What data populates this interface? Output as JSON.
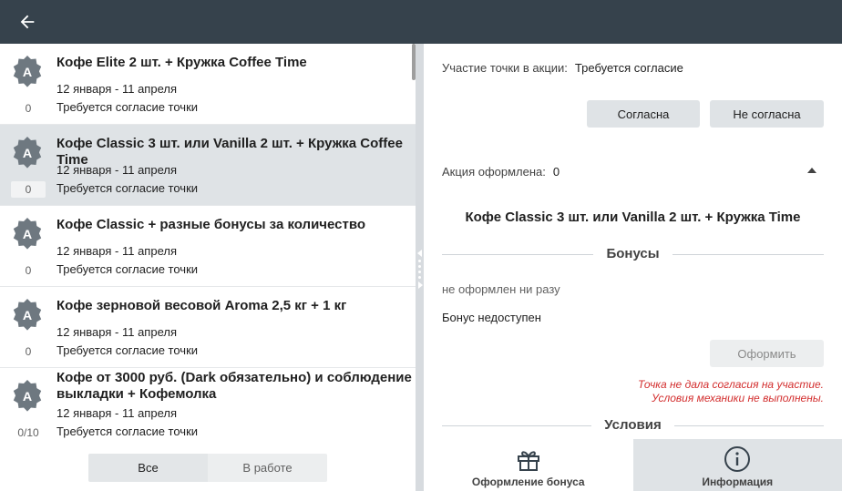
{
  "header": {
    "back_icon": "arrow-left-icon"
  },
  "promos": [
    {
      "title": "Кофе Elite 2 шт. + Кружка Coffee Time",
      "dates": "12 января - 11 апреля",
      "status": "Требуется согласие точки",
      "count": "0",
      "badge": "А",
      "badge_icon": "star-badge-icon"
    },
    {
      "title": "Кофе Classic 3 шт. или Vanilla 2 шт. + Кружка Coffee Time",
      "dates": "12 января - 11 апреля",
      "status": "Требуется согласие точки",
      "count": "0",
      "badge": "А",
      "badge_icon": "star-badge-icon"
    },
    {
      "title": "Кофе Classic + разные бонусы за количество",
      "dates": "12 января - 11 апреля",
      "status": "Требуется согласие точки",
      "count": "0",
      "badge": "А",
      "badge_icon": "star-badge-icon"
    },
    {
      "title": "Кофе зерновой весовой Aroma 2,5 кг + 1 кг",
      "dates": "12 января - 11 апреля",
      "status": "Требуется согласие точки",
      "count": "0",
      "badge": "А",
      "badge_icon": "star-badge-icon"
    },
    {
      "title": "Кофе от 3000 руб. (Dark обязательно) и соблюдение выкладки + Кофемолка",
      "dates": "12 января - 11 апреля",
      "status": "Требуется согласие точки",
      "count": "0/10",
      "badge": "А",
      "badge_icon": "star-badge-icon"
    }
  ],
  "filter": {
    "all": "Все",
    "in_work": "В работе"
  },
  "detail": {
    "participation_label": "Участие точки в акции:",
    "participation_value": "Требуется согласие",
    "agree": "Согласна",
    "disagree": "Не согласна",
    "issued_label": "Акция оформлена:",
    "issued_value": "0",
    "promo_name": "Кофе Classic 3 шт. или Vanilla 2 шт. + Кружка Time",
    "bonuses_header": "Бонусы",
    "not_issued": "не оформлен ни разу",
    "bonus_unavailable": "Бонус недоступен",
    "issue_button": "Оформить",
    "warning_1": "Точка не дала согласия на участие.",
    "warning_2": "Условия механики не выполнены.",
    "conditions_header": "Условия"
  },
  "bottom_nav": {
    "bonus_tab": "Оформление бонуса",
    "info_tab": "Информация"
  },
  "colors": {
    "topbar": "#36424c",
    "badge": "#6e7880",
    "warning": "#d32f2f",
    "selected_row": "#dfe3e6"
  }
}
